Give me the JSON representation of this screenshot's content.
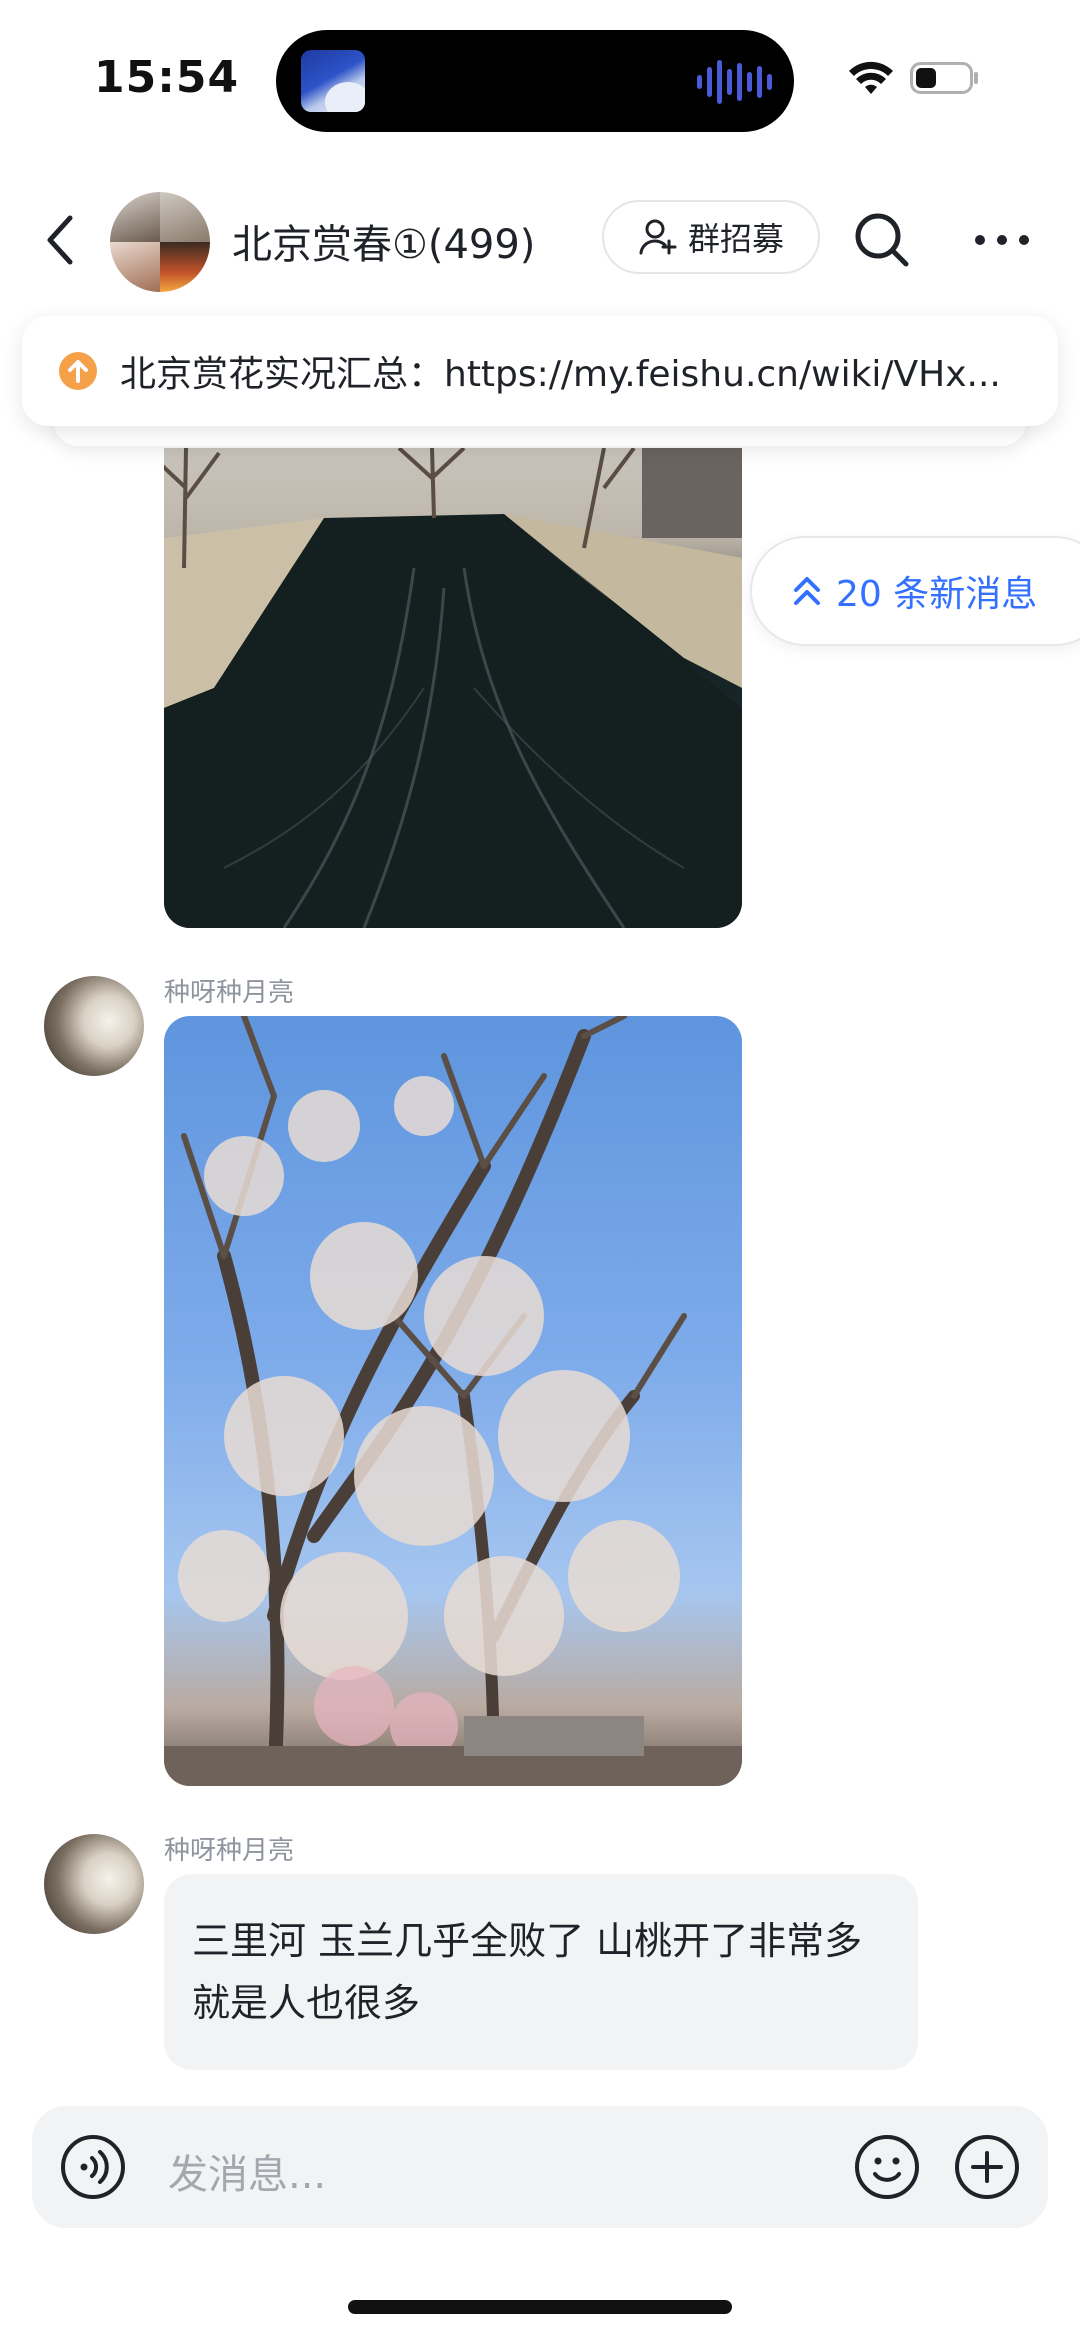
{
  "status_bar": {
    "time": "15:54"
  },
  "header": {
    "group_name": "北京赏春①(499)",
    "recruit_label": "群招募"
  },
  "pinned": {
    "text": "北京赏花实况汇总：https://my.feishu.cn/wiki/VHx..."
  },
  "new_messages": {
    "label": "20 条新消息"
  },
  "messages": [
    {
      "sender": "种呀种月亮",
      "type": "image",
      "description_icon": "photo"
    },
    {
      "sender": "种呀种月亮",
      "type": "text",
      "text": "三里河 玉兰几乎全败了 山桃开了非常多 就是人也很多"
    }
  ],
  "input": {
    "placeholder": "发消息..."
  },
  "colors": {
    "accent": "#3370ff",
    "pin_icon": "#f5a14a",
    "bubble_bg": "#f2f3f5",
    "muted_text": "#8f959e"
  }
}
